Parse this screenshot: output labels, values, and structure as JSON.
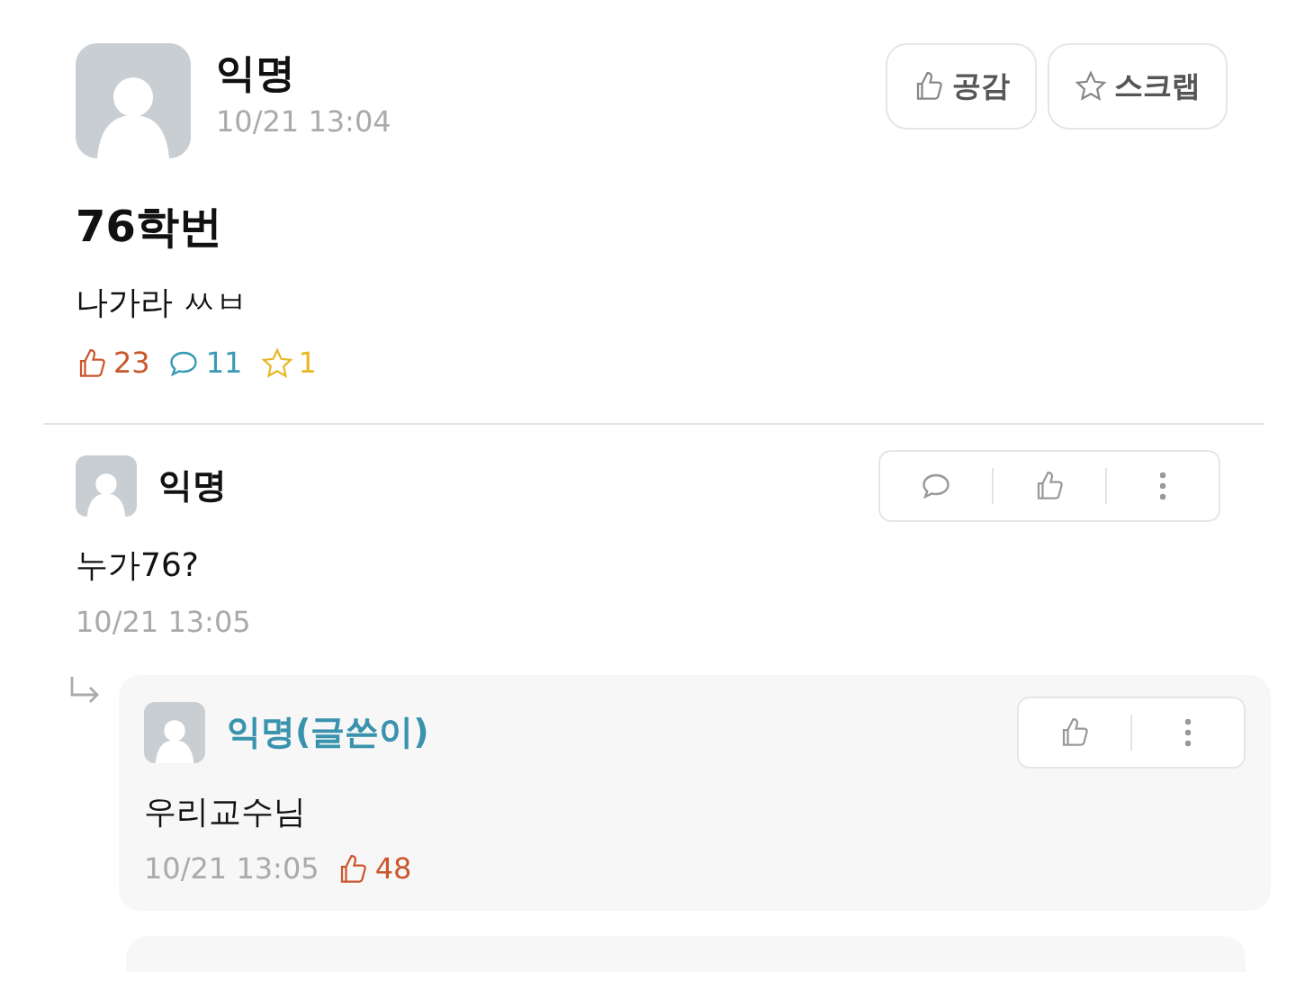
{
  "post": {
    "author": "익명",
    "time": "10/21 13:04",
    "buttons": [
      {
        "kind": "like",
        "label": "공감"
      },
      {
        "kind": "scrap",
        "label": "스크랩"
      }
    ],
    "title": "76학번",
    "body": "나가라 ㅆㅂ",
    "stats": [
      {
        "kind": "like",
        "count": "23",
        "color": "#c9572b"
      },
      {
        "kind": "comment",
        "count": "11",
        "color": "#3a9bb5"
      },
      {
        "kind": "scrap",
        "count": "1",
        "color": "#e8b824"
      }
    ]
  },
  "comments": [
    {
      "kind": "comment",
      "author": "익명",
      "is_writer": false,
      "body": "누가76?",
      "time": "10/21 13:05"
    },
    {
      "kind": "reply",
      "author": "익명(글쓴이)",
      "is_writer": true,
      "body": "우리교수님",
      "time": "10/21 13:05",
      "likes": "48"
    }
  ]
}
